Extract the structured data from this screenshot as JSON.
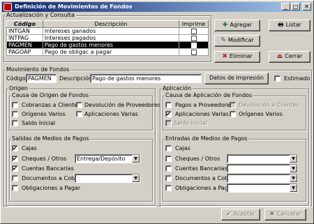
{
  "window": {
    "title": "Definición de Movimientos de Fondos",
    "minimize": "_",
    "maximize": "□",
    "close": "✕"
  },
  "actualizacion": {
    "legend": "Actualización y Consulta",
    "columns": [
      "Código",
      "Descripción",
      "Imprime"
    ],
    "rows": [
      {
        "codigo": "INTGAN",
        "descripcion": "Intereses ganados"
      },
      {
        "codigo": "INTPAG",
        "descripcion": "Intereses pagados"
      },
      {
        "codigo": "PAGMEN",
        "descripcion": "Pago de gastos menores"
      },
      {
        "codigo": "PAGOAP",
        "descripcion": "Pago de obligac a pagar"
      }
    ],
    "selected_row": 2
  },
  "buttons": {
    "agregar": "Agregar",
    "listar": "Listar",
    "modificar": "Modificar",
    "eliminar": "Eliminar",
    "cerrar": "Cerrar",
    "aceptar": "Aceptar",
    "cancelar": "Cancelar",
    "datos_impresion": "Datos de Impresión"
  },
  "movimiento": {
    "legend": "Movimiento de Fondos",
    "codigo_label": "Código:",
    "codigo_value": "PAGMEN",
    "descripcion_label": "Descripción:",
    "descripcion_value": "Pago de gastos menores",
    "estimado_label": "Estimado"
  },
  "origen": {
    "legend": "Origen",
    "causa": {
      "legend": "Causa de Origen de Fondos",
      "cobranzas": "Cobranzas a Clientes",
      "devolucion": "Devolución de Proveedores",
      "origenes_varios": "Orígenes Varios",
      "aplicaciones_varias": "Aplicaciones Varias",
      "saldo_inicial": "Saldo Inicial"
    },
    "salidas": {
      "legend": "Salidas de Medios de Pagos",
      "cajas": "Cajas",
      "cheques": "Cheques / Otros",
      "cheques_combo": "Entrega/Depósito",
      "cuentas": "Cuentas Bancarias",
      "documentos": "Documentos a Cobrar",
      "obligaciones": "Obligaciones a Pagar"
    }
  },
  "aplicacion": {
    "legend": "Aplicación",
    "causa": {
      "legend": "Causa de Aplicación de Fondos",
      "pagos": "Pagos a Proveedores",
      "devolucion": "Devolución a Clientes",
      "aplicaciones_varias": "Aplicaciones Varias",
      "origenes_varios": "Orígenes Varios",
      "saldo_inicial": "Saldo Inicial"
    },
    "entradas": {
      "legend": "Entradas de Medios de Pagos",
      "cajas": "Cajas",
      "cheques": "Cheques / Otros",
      "cuentas": "Cuentas Bancarias",
      "documentos": "Documentos a Cobrar",
      "obligaciones": "Obligaciones a Pagar"
    }
  },
  "colors": {
    "title_start": "#0a246a",
    "title_end": "#a6caf0",
    "face": "#d4d0c8",
    "selection": "#000000"
  }
}
